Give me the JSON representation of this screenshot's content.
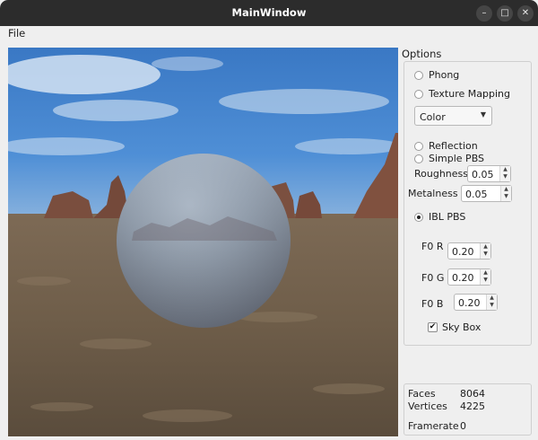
{
  "window": {
    "title": "MainWindow",
    "minimize": "–",
    "maximize": "□",
    "close": "✕"
  },
  "menu": {
    "file": "File"
  },
  "options": {
    "header": "Options",
    "phong": "Phong",
    "texture_mapping": "Texture Mapping",
    "texture_combo_value": "Color",
    "reflection": "Reflection",
    "simple_pbs": "Simple PBS",
    "roughness_label": "Roughness",
    "roughness_value": "0.05",
    "metalness_label": "Metalness",
    "metalness_value": "0.05",
    "ibl_pbs": "IBL PBS",
    "ibl_pbs_selected": true,
    "f0r_label": "F0 R",
    "f0r_value": "0.20",
    "f0g_label": "F0 G",
    "f0g_value": "0.20",
    "f0b_label": "F0 B",
    "f0b_value": "0.20",
    "skybox_label": "Sky Box",
    "skybox_checked": true
  },
  "stats": {
    "faces_label": "Faces",
    "faces_value": "8064",
    "vertices_label": "Vertices",
    "vertices_value": "4225",
    "framerate_label": "Framerate",
    "framerate_value": "0"
  },
  "colors": {
    "titlebar": "#2c2c2c",
    "window_bg": "#efefef",
    "sky": "#3f7fc9",
    "ground": "#6f5f4c",
    "sphere": "#8a93a0"
  }
}
